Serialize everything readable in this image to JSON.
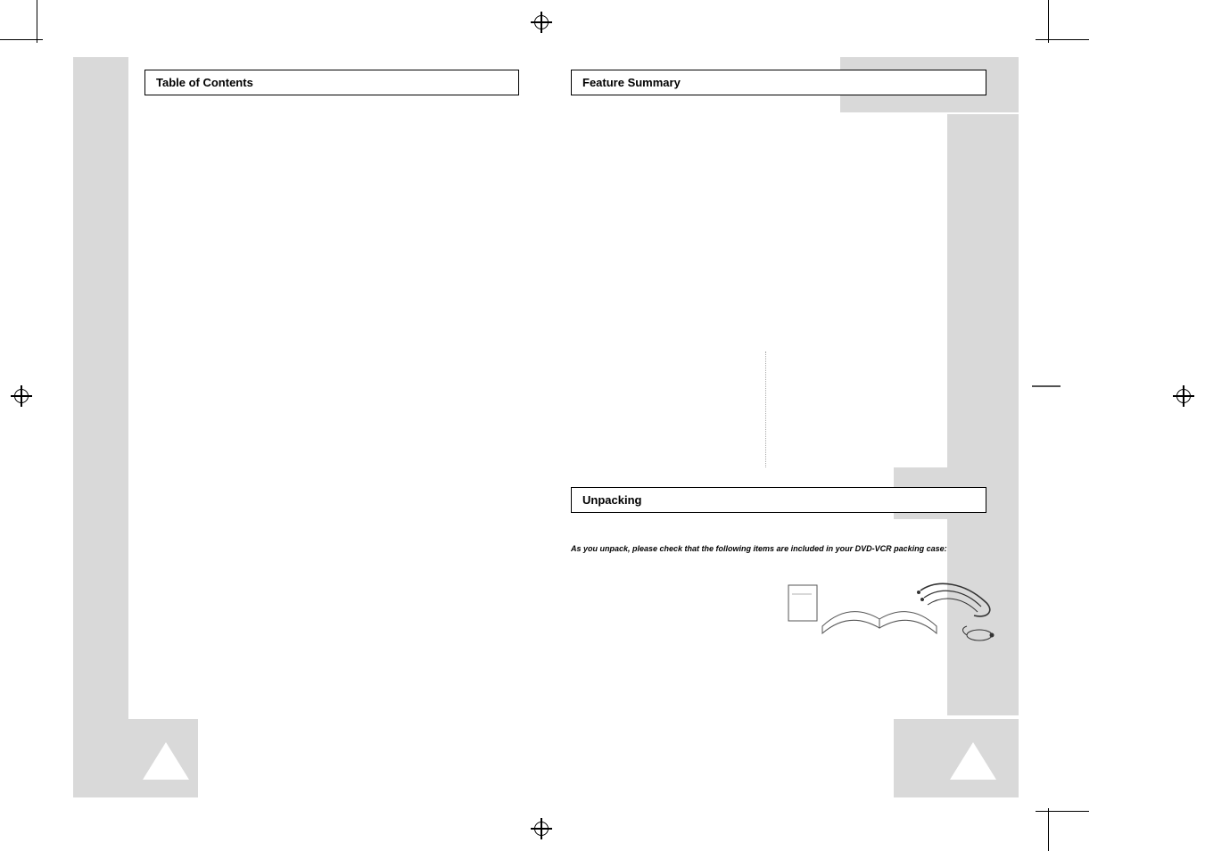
{
  "left_page": {
    "section_title": "Table of Contents"
  },
  "right_page": {
    "section_title_1": "Feature Summary",
    "section_title_2": "Unpacking",
    "unpack_note": "As you unpack, please check that the following items are included in your DVD-VCR packing case:",
    "accessory_labels": {
      "booklet": "booklet",
      "manual": "manual",
      "cables": "cables",
      "plug": "plug"
    }
  }
}
